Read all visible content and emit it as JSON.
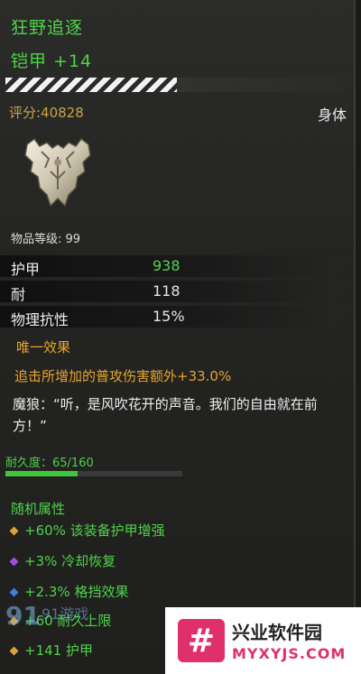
{
  "item": {
    "name": "狂野追逐",
    "type_line": "铠甲 +14",
    "upgrade_fraction": 0.5,
    "score": "评分:40828",
    "slot": "身体",
    "level": "物品等级: 99"
  },
  "stats": [
    {
      "key": "护甲",
      "value": "938",
      "highlight": true
    },
    {
      "key": "耐",
      "value": "118",
      "highlight": false
    },
    {
      "key": "物理抗性",
      "value": "15%",
      "highlight": false
    }
  ],
  "unique": {
    "title": "唯一效果",
    "desc": "追击所增加的普攻伤害额外+33.0%"
  },
  "quote": "魔狼：“听，是风吹花开的声音。我们的自由就在前方！”",
  "durability": {
    "label": "耐久度：65/160",
    "fraction": 0.40625
  },
  "random": {
    "title": "随机属性",
    "items": [
      {
        "text": "+60% 该装备护甲增强",
        "gem": "#d9a23e"
      },
      {
        "text": "+3% 冷却恢复",
        "gem": "#a24be0"
      },
      {
        "text": "+2.3% 格挡效果",
        "gem": "#3e7fe0"
      },
      {
        "text": "+60 耐久上限",
        "gem": "#d9a23e"
      },
      {
        "text": "+141 护甲",
        "gem": "#d9a23e"
      }
    ]
  },
  "watermark_left": "91游戏",
  "watermark": {
    "logo": "#",
    "title": "兴业软件园",
    "url": "MYXYJS.COM"
  },
  "colors": {
    "green": "#4ed34a",
    "gold": "#e6a52c",
    "brand": "#e0306b"
  },
  "icons": {
    "item": "shoulder-armor-icon",
    "gem": "diamond-gem-icon"
  }
}
